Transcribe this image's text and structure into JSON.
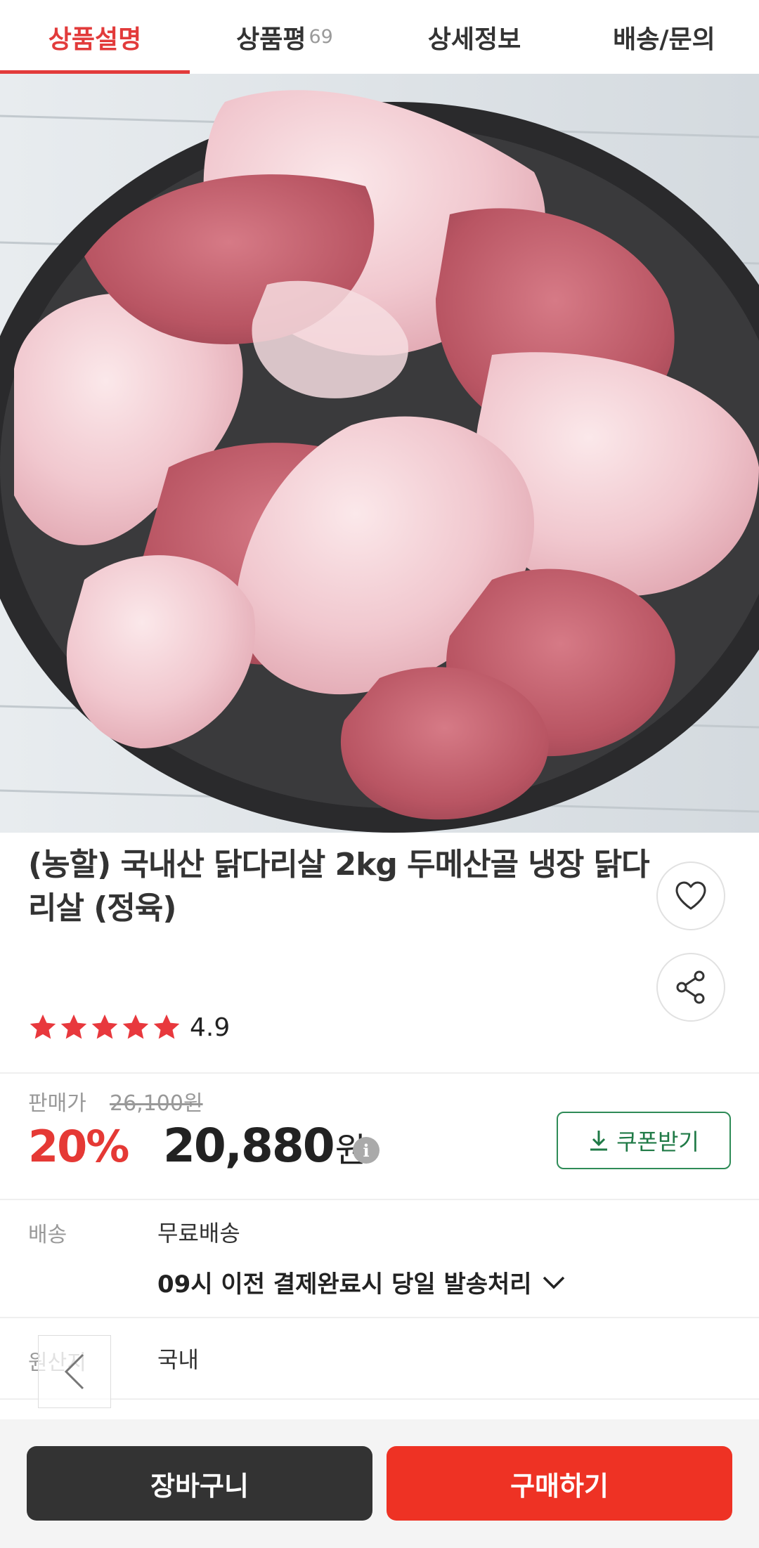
{
  "tabs": [
    {
      "label": "상품설명",
      "active": true
    },
    {
      "label": "상품평",
      "count": "69"
    },
    {
      "label": "상세정보"
    },
    {
      "label": "배송/문의"
    }
  ],
  "product": {
    "title": "(농할) 국내산 닭다리살 2kg 두메산골 냉장 닭다리살 (정육)",
    "image_icon": "raw-chicken-thigh-photo",
    "rating": "4.9",
    "rating_stars": 5
  },
  "price": {
    "label": "판매가",
    "original": "26,100원",
    "discount": "20%",
    "sale_amount": "20,880",
    "currency": "원",
    "coupon_label": "쿠폰받기"
  },
  "shipping": {
    "label": "배송",
    "value": "무료배송",
    "note": "09시 이전 결제완료시 당일 발송처리"
  },
  "origin": {
    "label": "원산지",
    "value": "국내"
  },
  "actions": {
    "cart_label": "장바구니",
    "buy_label": "구매하기"
  },
  "colors": {
    "accent_red": "#e23b3b",
    "buy_red": "#ee3224",
    "coupon_green": "#1f7a46",
    "cart_dark": "#333333"
  }
}
